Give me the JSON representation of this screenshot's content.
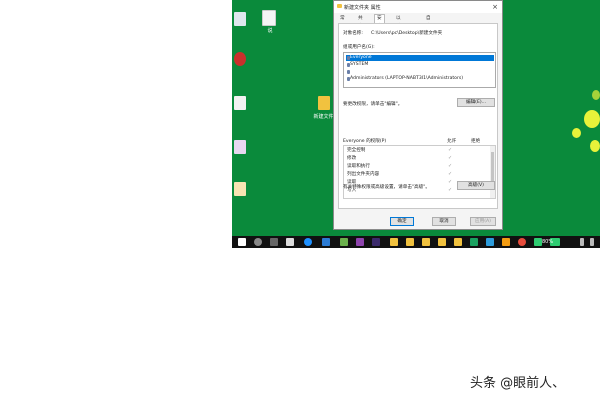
{
  "window": {
    "title": "新建文件夹 属性",
    "tabs": [
      "常规",
      "共享",
      "安全",
      "以前的版本",
      "自定义"
    ],
    "active_tab": "安全"
  },
  "security": {
    "object_name_label": "对象名称:",
    "object_name_value": "C:\\Users\\pc\\Desktop\\新建文件夹",
    "group_label": "组或用户名(G):",
    "users": [
      "Everyone",
      "SYSTEM",
      "",
      "Administrators (LAPTOP-NABT3I1\\Administrators)"
    ],
    "selected_user": "Everyone",
    "edit_hint": "要更改权限，请单击\"编辑\"。",
    "edit_button": "编辑(E)...",
    "perm_header": "Everyone 的权限(P)",
    "allow_label": "允许",
    "deny_label": "拒绝",
    "permissions": [
      "完全控制",
      "修改",
      "读取和执行",
      "列出文件夹内容",
      "读取",
      "写入"
    ],
    "advanced_hint": "有关特殊权限或高级设置，请单击\"高级\"。",
    "advanced_button": "高级(V)"
  },
  "footer": {
    "ok": "确定",
    "cancel": "取消",
    "apply": "应用(A)"
  },
  "desktop": {
    "folder_label": "新建文件夹",
    "icon_label_2": "说"
  },
  "taskbar": {
    "battery": "80%"
  },
  "watermark": "头条 @眼前人、"
}
